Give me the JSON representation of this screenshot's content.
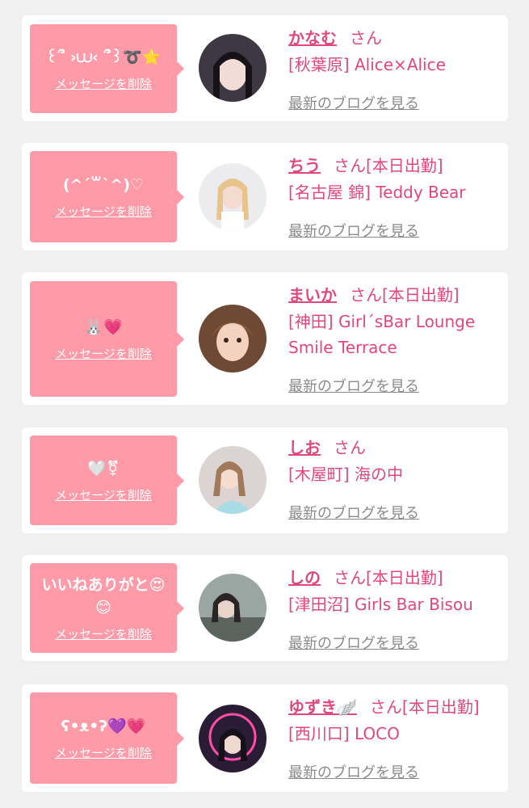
{
  "cards": [
    {
      "message": "꒰՞ ›⩊‹ ՞꒱➰⭐",
      "delete": "メッセージを削除",
      "name": "かなむ",
      "san": "さん",
      "badge": "",
      "shop": "[秋葉原] Alice×Alice",
      "blog": "最新のブログを見る",
      "avatar_bg": "#4a4350"
    },
    {
      "message": "(^ˊ꒳ˋ^)♡",
      "delete": "メッセージを削除",
      "name": "ちう",
      "san": "さん",
      "badge": "[本日出勤]",
      "shop": "[名古屋 錦] Teddy Bear",
      "blog": "最新のブログを見る",
      "avatar_bg": "#e9e6e8"
    },
    {
      "message": "🐰💗",
      "delete": "メッセージを削除",
      "name": "まいか",
      "san": "さん",
      "badge": "[本日出勤]",
      "shop": "[神田] Girl´sBar Lounge Smile Terrace",
      "blog": "最新のブログを見る",
      "avatar_bg": "#8a5a3c"
    },
    {
      "message": "🤍⚧",
      "delete": "メッセージを削除",
      "name": "しお",
      "san": "さん",
      "badge": "",
      "shop": "[木屋町] 海の中",
      "blog": "最新のブログを見る",
      "avatar_bg": "#d8c8c4"
    },
    {
      "message": "いいねありがと😍😊",
      "delete": "メッセージを削除",
      "name": "しの",
      "san": "さん",
      "badge": "[本日出勤]",
      "shop": "[津田沼] Girls Bar Bisou",
      "blog": "最新のブログを見る",
      "avatar_bg": "#7c8a86"
    },
    {
      "message": "ʕ•ᴥ•ʔ💜💗",
      "delete": "メッセージを削除",
      "name": "ゆずき🪽",
      "san": "さん",
      "badge": "[本日出勤]",
      "shop": "[西川口] LOCO",
      "blog": "最新のブログを見る",
      "avatar_bg": "#2b2038"
    }
  ]
}
